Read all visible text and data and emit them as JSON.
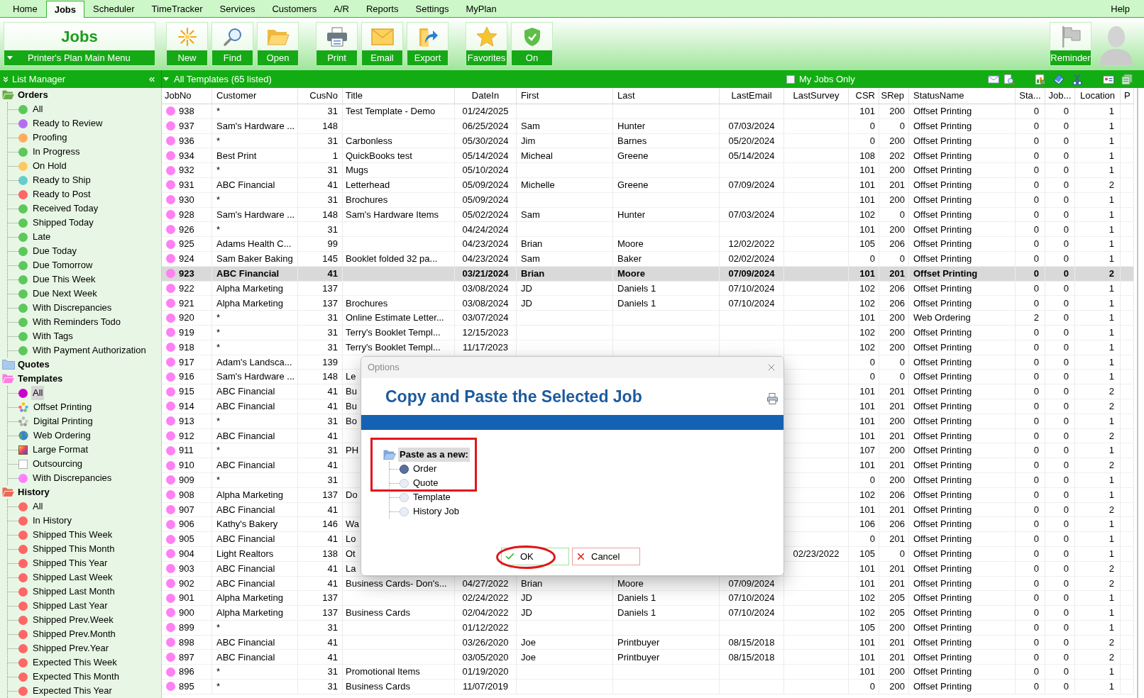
{
  "menu_bar": {
    "tabs": [
      {
        "label": "Home",
        "selected": false
      },
      {
        "label": "Jobs",
        "selected": true
      },
      {
        "label": "Scheduler",
        "selected": false
      },
      {
        "label": "TimeTracker",
        "selected": false
      },
      {
        "label": "Services",
        "selected": false
      },
      {
        "label": "Customers",
        "selected": false
      },
      {
        "label": "A/R",
        "selected": false
      },
      {
        "label": "Reports",
        "selected": false
      },
      {
        "label": "Settings",
        "selected": false
      },
      {
        "label": "MyPlan",
        "selected": false
      }
    ],
    "help": "Help"
  },
  "ribbon": {
    "module_title": "Jobs",
    "main_menu": "Printer's Plan Main Menu",
    "button_groups": [
      [
        {
          "label": "New",
          "kind": "new"
        },
        {
          "label": "Find",
          "kind": "find"
        },
        {
          "label": "Open",
          "kind": "open"
        }
      ],
      [
        {
          "label": "Print",
          "kind": "print"
        },
        {
          "label": "Email",
          "kind": "email"
        },
        {
          "label": "Export",
          "kind": "export"
        }
      ],
      [
        {
          "label": "Favorites",
          "kind": "favorites"
        },
        {
          "label": "On",
          "kind": "on"
        }
      ]
    ],
    "reminder": "Reminder"
  },
  "list_manager": {
    "title": "List Manager",
    "groups": [
      {
        "label": "Orders",
        "color": "#6aae4a",
        "expanded": true,
        "selected": false,
        "children": [
          {
            "label": "All",
            "kind": "dot",
            "color": "#5cc85c",
            "selected": false
          },
          {
            "label": "Ready to Review",
            "kind": "dot",
            "color": "#b36ef5",
            "selected": false
          },
          {
            "label": "Proofing",
            "kind": "dot",
            "color": "#ffac5e",
            "selected": false
          },
          {
            "label": "In Progress",
            "kind": "dot",
            "color": "#5cc85c",
            "selected": false
          },
          {
            "label": "On Hold",
            "kind": "dot",
            "color": "#ffc864",
            "selected": false
          },
          {
            "label": "Ready to Ship",
            "kind": "dot",
            "color": "#66cccc",
            "selected": false
          },
          {
            "label": "Ready to Post",
            "kind": "dot",
            "color": "#ff6666",
            "selected": false
          },
          {
            "label": "Received Today",
            "kind": "dot",
            "color": "#5cc85c",
            "selected": false
          },
          {
            "label": "Shipped Today",
            "kind": "dot",
            "color": "#5cc85c",
            "selected": false
          },
          {
            "label": "Late",
            "kind": "dot",
            "color": "#5cc85c",
            "selected": false
          },
          {
            "label": "Due Today",
            "kind": "dot",
            "color": "#5cc85c",
            "selected": false
          },
          {
            "label": "Due Tomorrow",
            "kind": "dot",
            "color": "#5cc85c",
            "selected": false
          },
          {
            "label": "Due This Week",
            "kind": "dot",
            "color": "#5cc85c",
            "selected": false
          },
          {
            "label": "Due Next Week",
            "kind": "dot",
            "color": "#5cc85c",
            "selected": false
          },
          {
            "label": "With Discrepancies",
            "kind": "dot",
            "color": "#5cc85c",
            "selected": false
          },
          {
            "label": "With Reminders Todo",
            "kind": "dot",
            "color": "#5cc85c",
            "selected": false
          },
          {
            "label": "With Tags",
            "kind": "dot",
            "color": "#5cc85c",
            "selected": false
          },
          {
            "label": "With Payment Authorization",
            "kind": "dot",
            "color": "#5cc85c",
            "selected": false
          }
        ]
      },
      {
        "label": "Quotes",
        "color": "#a9c9ef",
        "expanded": false,
        "selected": false
      },
      {
        "label": "Templates",
        "color": "#ff7de0",
        "expanded": true,
        "selected": false,
        "children": [
          {
            "label": "All",
            "kind": "dot",
            "color": "#cc00cc",
            "selected": true
          },
          {
            "label": "Offset Printing",
            "kind": "color-dots",
            "selected": false
          },
          {
            "label": "Digital Printing",
            "kind": "grey-dots",
            "selected": false
          },
          {
            "label": "Web Ordering",
            "kind": "globe",
            "selected": false
          },
          {
            "label": "Large Format",
            "kind": "gradient-square",
            "selected": false
          },
          {
            "label": "Outsourcing",
            "kind": "white-square",
            "selected": false
          },
          {
            "label": "With Discrepancies",
            "kind": "dot",
            "color": "#ff80ff",
            "selected": false
          }
        ]
      },
      {
        "label": "History",
        "color": "#ea6a55",
        "expanded": true,
        "selected": false,
        "children": [
          {
            "label": "All",
            "kind": "dot",
            "color": "#ff6666",
            "selected": false
          },
          {
            "label": "In History",
            "kind": "dot",
            "color": "#ff6666",
            "selected": false
          },
          {
            "label": "Shipped This Week",
            "kind": "dot",
            "color": "#ff6666",
            "selected": false
          },
          {
            "label": "Shipped This Month",
            "kind": "dot",
            "color": "#ff6666",
            "selected": false
          },
          {
            "label": "Shipped This Year",
            "kind": "dot",
            "color": "#ff6666",
            "selected": false
          },
          {
            "label": "Shipped Last Week",
            "kind": "dot",
            "color": "#ff6666",
            "selected": false
          },
          {
            "label": "Shipped Last Month",
            "kind": "dot",
            "color": "#ff6666",
            "selected": false
          },
          {
            "label": "Shipped Last Year",
            "kind": "dot",
            "color": "#ff6666",
            "selected": false
          },
          {
            "label": "Shipped Prev.Week",
            "kind": "dot",
            "color": "#ff6666",
            "selected": false
          },
          {
            "label": "Shipped Prev.Month",
            "kind": "dot",
            "color": "#ff6666",
            "selected": false
          },
          {
            "label": "Shipped Prev.Year",
            "kind": "dot",
            "color": "#ff6666",
            "selected": false
          },
          {
            "label": "Expected This Week",
            "kind": "dot",
            "color": "#ff6666",
            "selected": false
          },
          {
            "label": "Expected This Month",
            "kind": "dot",
            "color": "#ff6666",
            "selected": false
          },
          {
            "label": "Expected This Year",
            "kind": "dot",
            "color": "#ff6666",
            "selected": false
          }
        ]
      }
    ]
  },
  "list_view": {
    "title": "All Templates (65 listed)",
    "my_jobs_only": {
      "label": "My Jobs Only",
      "checked": false
    }
  },
  "table": {
    "columns": [
      "JobNo",
      "Customer",
      "CusNo",
      "Title",
      "DateIn",
      "First",
      "Last",
      "LastEmail",
      "LastSurvey",
      "CSR",
      "SRep",
      "StatusName",
      "Sta...",
      "Job...",
      "Location",
      "P"
    ],
    "rows": [
      {
        "job_no": "938",
        "customer": "*",
        "cus_no": "31",
        "title": "Test Template - Demo",
        "date_in": "01/24/2025",
        "csr": "101",
        "srep": "200",
        "status_name": "Offset Printing",
        "sta": "0",
        "job": "0",
        "location": "1",
        "selected": false
      },
      {
        "job_no": "937",
        "customer": "Sam's Hardware ...",
        "cus_no": "148",
        "date_in": "06/25/2024",
        "first": "Sam",
        "last": "Hunter",
        "last_email": "07/03/2024",
        "csr": "0",
        "srep": "0",
        "status_name": "Offset Printing",
        "sta": "0",
        "job": "0",
        "location": "1",
        "selected": false
      },
      {
        "job_no": "936",
        "customer": "*",
        "cus_no": "31",
        "title": "Carbonless",
        "date_in": "05/30/2024",
        "first": "Jim",
        "last": "Barnes",
        "last_email": "05/20/2024",
        "csr": "0",
        "srep": "200",
        "status_name": "Offset Printing",
        "sta": "0",
        "job": "0",
        "location": "1",
        "selected": false
      },
      {
        "job_no": "934",
        "customer": "Best Print",
        "cus_no": "1",
        "title": "QuickBooks test",
        "date_in": "05/14/2024",
        "first": "Micheal",
        "last": "Greene",
        "last_email": "05/14/2024",
        "csr": "108",
        "srep": "202",
        "status_name": "Offset Printing",
        "sta": "0",
        "job": "0",
        "location": "1",
        "selected": false
      },
      {
        "job_no": "932",
        "customer": "*",
        "cus_no": "31",
        "title": "Mugs",
        "date_in": "05/10/2024",
        "csr": "101",
        "srep": "200",
        "status_name": "Offset Printing",
        "sta": "0",
        "job": "0",
        "location": "1",
        "selected": false
      },
      {
        "job_no": "931",
        "customer": "ABC Financial",
        "cus_no": "41",
        "title": "Letterhead",
        "date_in": "05/09/2024",
        "first": "Michelle",
        "last": "Greene",
        "last_email": "07/09/2024",
        "csr": "101",
        "srep": "201",
        "status_name": "Offset Printing",
        "sta": "0",
        "job": "0",
        "location": "2",
        "selected": false
      },
      {
        "job_no": "930",
        "customer": "*",
        "cus_no": "31",
        "title": "Brochures",
        "date_in": "05/09/2024",
        "csr": "101",
        "srep": "200",
        "status_name": "Offset Printing",
        "sta": "0",
        "job": "0",
        "location": "1",
        "selected": false
      },
      {
        "job_no": "928",
        "customer": "Sam's Hardware ...",
        "cus_no": "148",
        "title": "Sam's Hardware Items",
        "date_in": "05/02/2024",
        "first": "Sam",
        "last": "Hunter",
        "last_email": "07/03/2024",
        "csr": "102",
        "srep": "0",
        "status_name": "Offset Printing",
        "sta": "0",
        "job": "0",
        "location": "1",
        "selected": false
      },
      {
        "job_no": "926",
        "customer": "*",
        "cus_no": "31",
        "date_in": "04/24/2024",
        "csr": "101",
        "srep": "200",
        "status_name": "Offset Printing",
        "sta": "0",
        "job": "0",
        "location": "1",
        "selected": false
      },
      {
        "job_no": "925",
        "customer": "Adams Health C...",
        "cus_no": "99",
        "date_in": "04/23/2024",
        "first": "Brian",
        "last": "Moore",
        "last_email": "12/02/2022",
        "csr": "105",
        "srep": "206",
        "status_name": "Offset Printing",
        "sta": "0",
        "job": "0",
        "location": "1",
        "selected": false
      },
      {
        "job_no": "924",
        "customer": "Sam Baker Baking",
        "cus_no": "145",
        "title": "Booklet folded 32 pa...",
        "date_in": "04/23/2024",
        "first": "Sam",
        "last": "Baker",
        "last_email": "02/02/2024",
        "csr": "0",
        "srep": "0",
        "status_name": "Offset Printing",
        "sta": "0",
        "job": "0",
        "location": "1",
        "selected": false
      },
      {
        "job_no": "923",
        "customer": "ABC Financial",
        "cus_no": "41",
        "date_in": "03/21/2024",
        "first": "Brian",
        "last": "Moore",
        "last_email": "07/09/2024",
        "csr": "101",
        "srep": "201",
        "status_name": "Offset Printing",
        "sta": "0",
        "job": "0",
        "location": "2",
        "selected": true
      },
      {
        "job_no": "922",
        "customer": "Alpha Marketing",
        "cus_no": "137",
        "date_in": "03/08/2024",
        "first": "JD",
        "last": "Daniels 1",
        "last_email": "07/10/2024",
        "csr": "102",
        "srep": "206",
        "status_name": "Offset Printing",
        "sta": "0",
        "job": "0",
        "location": "1",
        "selected": false
      },
      {
        "job_no": "921",
        "customer": "Alpha Marketing",
        "cus_no": "137",
        "title": "Brochures",
        "date_in": "03/08/2024",
        "first": "JD",
        "last": "Daniels 1",
        "last_email": "07/10/2024",
        "csr": "102",
        "srep": "206",
        "status_name": "Offset Printing",
        "sta": "0",
        "job": "0",
        "location": "1",
        "selected": false
      },
      {
        "job_no": "920",
        "customer": "*",
        "cus_no": "31",
        "title": "Online Estimate Letter...",
        "date_in": "03/07/2024",
        "csr": "101",
        "srep": "200",
        "status_name": "Web Ordering",
        "sta": "2",
        "job": "0",
        "location": "1",
        "selected": false
      },
      {
        "job_no": "919",
        "customer": "*",
        "cus_no": "31",
        "title": "Terry's Booklet Templ...",
        "date_in": "12/15/2023",
        "csr": "102",
        "srep": "200",
        "status_name": "Offset Printing",
        "sta": "0",
        "job": "0",
        "location": "1",
        "selected": false
      },
      {
        "job_no": "918",
        "customer": "*",
        "cus_no": "31",
        "title": "Terry's Booklet Templ...",
        "date_in": "11/17/2023",
        "csr": "102",
        "srep": "200",
        "status_name": "Offset Printing",
        "sta": "0",
        "job": "0",
        "location": "1",
        "selected": false
      },
      {
        "job_no": "917",
        "customer": "Adam's Landsca...",
        "cus_no": "139",
        "csr": "0",
        "srep": "0",
        "status_name": "Offset Printing",
        "sta": "0",
        "job": "0",
        "location": "1",
        "selected": false
      },
      {
        "job_no": "916",
        "customer": "Sam's Hardware ...",
        "cus_no": "148",
        "title": "Le",
        "csr": "0",
        "srep": "0",
        "status_name": "Offset Printing",
        "sta": "0",
        "job": "0",
        "location": "1",
        "selected": false
      },
      {
        "job_no": "915",
        "customer": "ABC Financial",
        "cus_no": "41",
        "title": "Bu",
        "csr": "101",
        "srep": "201",
        "status_name": "Offset Printing",
        "sta": "0",
        "job": "0",
        "location": "2",
        "selected": false
      },
      {
        "job_no": "914",
        "customer": "ABC Financial",
        "cus_no": "41",
        "title": "Bu",
        "csr": "101",
        "srep": "201",
        "status_name": "Offset Printing",
        "sta": "0",
        "job": "0",
        "location": "2",
        "selected": false
      },
      {
        "job_no": "913",
        "customer": "*",
        "cus_no": "31",
        "title": "Bo",
        "csr": "101",
        "srep": "200",
        "status_name": "Offset Printing",
        "sta": "0",
        "job": "0",
        "location": "1",
        "selected": false
      },
      {
        "job_no": "912",
        "customer": "ABC Financial",
        "cus_no": "41",
        "csr": "101",
        "srep": "201",
        "status_name": "Offset Printing",
        "sta": "0",
        "job": "0",
        "location": "2",
        "selected": false
      },
      {
        "job_no": "911",
        "customer": "*",
        "cus_no": "31",
        "title": "PH",
        "csr": "107",
        "srep": "200",
        "status_name": "Offset Printing",
        "sta": "0",
        "job": "0",
        "location": "1",
        "selected": false
      },
      {
        "job_no": "910",
        "customer": "ABC Financial",
        "cus_no": "41",
        "csr": "101",
        "srep": "201",
        "status_name": "Offset Printing",
        "sta": "0",
        "job": "0",
        "location": "2",
        "selected": false
      },
      {
        "job_no": "909",
        "customer": "*",
        "cus_no": "31",
        "csr": "0",
        "srep": "200",
        "status_name": "Offset Printing",
        "sta": "0",
        "job": "0",
        "location": "1",
        "selected": false
      },
      {
        "job_no": "908",
        "customer": "Alpha Marketing",
        "cus_no": "137",
        "title": "Do",
        "csr": "102",
        "srep": "206",
        "status_name": "Offset Printing",
        "sta": "0",
        "job": "0",
        "location": "1",
        "selected": false
      },
      {
        "job_no": "907",
        "customer": "ABC Financial",
        "cus_no": "41",
        "csr": "101",
        "srep": "201",
        "status_name": "Offset Printing",
        "sta": "0",
        "job": "0",
        "location": "2",
        "selected": false
      },
      {
        "job_no": "906",
        "customer": "Kathy's Bakery",
        "cus_no": "146",
        "title": "Wa",
        "csr": "106",
        "srep": "206",
        "status_name": "Offset Printing",
        "sta": "0",
        "job": "0",
        "location": "1",
        "selected": false
      },
      {
        "job_no": "905",
        "customer": "ABC Financial",
        "cus_no": "41",
        "title": "Lo",
        "csr": "0",
        "srep": "201",
        "status_name": "Offset Printing",
        "sta": "0",
        "job": "0",
        "location": "1",
        "selected": false
      },
      {
        "job_no": "904",
        "customer": "Light Realtors",
        "cus_no": "138",
        "title": "Ot",
        "last_survey": "02/23/2022",
        "csr": "105",
        "srep": "0",
        "status_name": "Offset Printing",
        "sta": "0",
        "job": "0",
        "location": "1",
        "selected": false
      },
      {
        "job_no": "903",
        "customer": "ABC Financial",
        "cus_no": "41",
        "title": "La",
        "csr": "101",
        "srep": "201",
        "status_name": "Offset Printing",
        "sta": "0",
        "job": "0",
        "location": "2",
        "selected": false
      },
      {
        "job_no": "902",
        "customer": "ABC Financial",
        "cus_no": "41",
        "title": "Business Cards- Don's...",
        "date_in": "04/27/2022",
        "first": "Brian",
        "last": "Moore",
        "last_email": "07/09/2024",
        "csr": "101",
        "srep": "201",
        "status_name": "Offset Printing",
        "sta": "0",
        "job": "0",
        "location": "2",
        "selected": false
      },
      {
        "job_no": "901",
        "customer": "Alpha Marketing",
        "cus_no": "137",
        "date_in": "02/24/2022",
        "first": "JD",
        "last": "Daniels 1",
        "last_email": "07/10/2024",
        "csr": "102",
        "srep": "205",
        "status_name": "Offset Printing",
        "sta": "0",
        "job": "0",
        "location": "1",
        "selected": false
      },
      {
        "job_no": "900",
        "customer": "Alpha Marketing",
        "cus_no": "137",
        "title": "Business Cards",
        "date_in": "02/04/2022",
        "first": "JD",
        "last": "Daniels 1",
        "last_email": "07/10/2024",
        "csr": "102",
        "srep": "205",
        "status_name": "Offset Printing",
        "sta": "0",
        "job": "0",
        "location": "1",
        "selected": false
      },
      {
        "job_no": "899",
        "customer": "*",
        "cus_no": "31",
        "date_in": "01/12/2022",
        "csr": "105",
        "srep": "200",
        "status_name": "Offset Printing",
        "sta": "0",
        "job": "0",
        "location": "1",
        "selected": false
      },
      {
        "job_no": "898",
        "customer": "ABC Financial",
        "cus_no": "41",
        "date_in": "03/26/2020",
        "first": "Joe",
        "last": "Printbuyer",
        "last_email": "08/15/2018",
        "csr": "101",
        "srep": "201",
        "status_name": "Offset Printing",
        "sta": "0",
        "job": "0",
        "location": "2",
        "selected": false
      },
      {
        "job_no": "897",
        "customer": "ABC Financial",
        "cus_no": "41",
        "date_in": "03/05/2020",
        "first": "Joe",
        "last": "Printbuyer",
        "last_email": "08/15/2018",
        "csr": "101",
        "srep": "201",
        "status_name": "Offset Printing",
        "sta": "0",
        "job": "0",
        "location": "2",
        "selected": false
      },
      {
        "job_no": "896",
        "customer": "*",
        "cus_no": "31",
        "title": "Promotional Items",
        "date_in": "01/19/2020",
        "csr": "101",
        "srep": "200",
        "status_name": "Offset Printing",
        "sta": "0",
        "job": "0",
        "location": "1",
        "selected": false
      },
      {
        "job_no": "895",
        "customer": "*",
        "cus_no": "31",
        "title": "Business Cards",
        "date_in": "11/07/2019",
        "csr": "0",
        "srep": "200",
        "status_name": "Offset Printing",
        "sta": "0",
        "job": "0",
        "location": "1",
        "selected": false
      }
    ]
  },
  "dialog": {
    "title": "Options",
    "heading": "Copy and Paste the Selected Job",
    "paste_as": {
      "label": "Paste as a new:",
      "options": [
        {
          "label": "Order",
          "selected": true
        },
        {
          "label": "Quote",
          "selected": false
        },
        {
          "label": "Template",
          "selected": false
        },
        {
          "label": "History Job",
          "selected": false
        }
      ]
    },
    "buttons": [
      {
        "label": "OK",
        "kind": "ok"
      },
      {
        "label": "Cancel",
        "kind": "cancel"
      }
    ]
  }
}
